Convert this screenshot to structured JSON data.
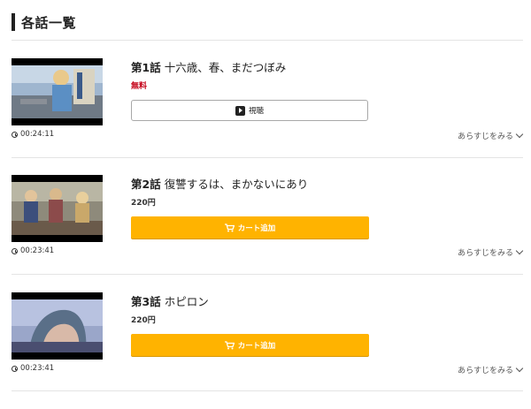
{
  "section_title": "各話一覧",
  "episodes": [
    {
      "number": "第1話",
      "title": "十六歳、春、まだつぼみ",
      "price": "無料",
      "duration": "00:24:11",
      "button_label": "視聴",
      "button_type": "watch",
      "synopsis_label": "あらすじをみる"
    },
    {
      "number": "第2話",
      "title": "復讐するは、まかないにあり",
      "price": "220円",
      "duration": "00:23:41",
      "button_label": "カート追加",
      "button_type": "cart",
      "synopsis_label": "あらすじをみる"
    },
    {
      "number": "第3話",
      "title": "ホピロン",
      "price": "220円",
      "duration": "00:23:41",
      "button_label": "カート追加",
      "button_type": "cart",
      "synopsis_label": "あらすじをみる"
    }
  ],
  "colors": {
    "cart_button": "#ffb300",
    "free_price": "#c40016"
  }
}
